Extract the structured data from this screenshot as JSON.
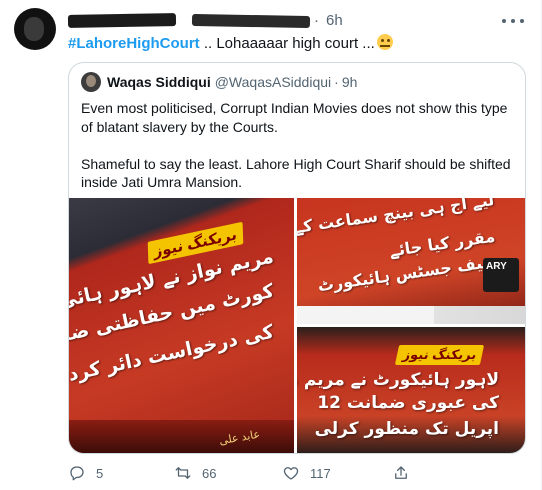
{
  "tweet": {
    "time": "6h",
    "separator": "·",
    "hashtag": "#LahoreHighCourt",
    "text": " .. Lohaaaaar high court ...",
    "emoji": "thinking-face-emoji"
  },
  "quote": {
    "name": "Waqas Siddiqui",
    "handle": "@WaqasASiddiqui",
    "separator": "·",
    "time": "9h",
    "paragraph1": "Even most politicised, Corrupt Indian Movies does not show this type of blatant slavery by the Courts.",
    "paragraph2": "Shameful to say the least. Lahore High Court Sharif should be shifted inside Jati Umra Mansion.",
    "images": {
      "img1": {
        "banner": "بریکنگ نیوز",
        "line1": "مریم نواز نے لاہور ہائی",
        "line2": "کورٹ میں حفاظتی ضمانت",
        "line3": "کی درخواست دائر کردی",
        "line4": "",
        "watermark": "عابد علی"
      },
      "img2": {
        "line1": "لیے آج ہی بینچ سماعت کے",
        "line2": "مقرر کیا جائے",
        "line3": "چیف جسٹس ہائیکورٹ",
        "logo": "ARY"
      },
      "img3": {
        "banner": "بریکنگ نیوز",
        "line1": "لاہور ہائیکورٹ نے مریم نواز",
        "line2": "کی عبوری ضمانت 12",
        "line3": "اپریل تک منظور کرلی"
      }
    }
  },
  "actions": {
    "reply_count": "5",
    "retweet_count": "66",
    "like_count": "117",
    "share_count": ""
  },
  "colors": {
    "accent": "#1d9bf0",
    "muted": "#536471",
    "border": "#cfd9de"
  }
}
